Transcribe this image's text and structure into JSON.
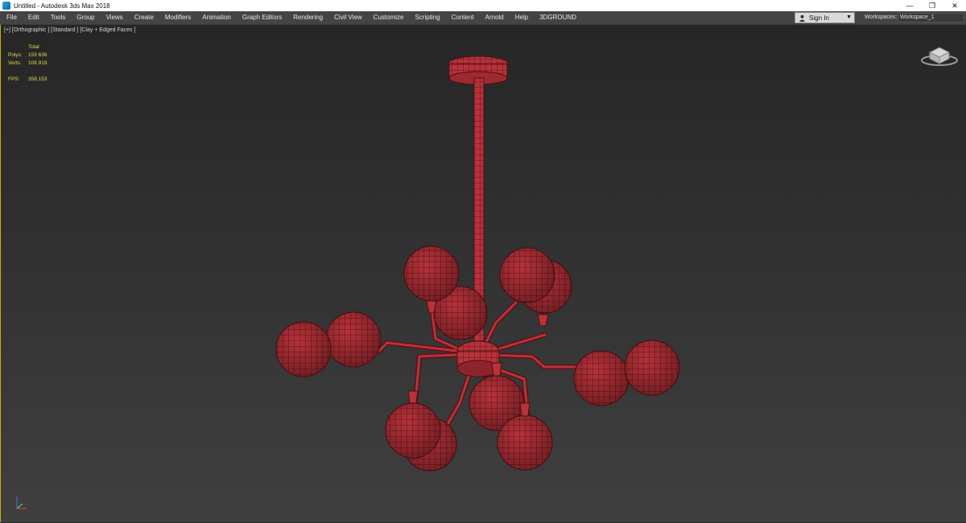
{
  "window": {
    "title": "Untitled - Autodesk 3ds Max 2018",
    "controls": [
      "—",
      "❐",
      "✕"
    ]
  },
  "menu": {
    "items": [
      "File",
      "Edit",
      "Tools",
      "Group",
      "Views",
      "Create",
      "Modifiers",
      "Animation",
      "Graph Editors",
      "Rendering",
      "Civil View",
      "Customize",
      "Scripting",
      "Content",
      "Arnold",
      "Help",
      "3DGROUND"
    ],
    "sign_in": "Sign In",
    "workspaces_label": "Workspaces:",
    "workspace_value": "Workspace_1"
  },
  "viewport": {
    "label": "[+] [Orthographic ] [Standard ] [Clay + Edged Faces ]",
    "stats": {
      "header": "Total",
      "polys_label": "Polys:",
      "polys_value": "159 636",
      "verts_label": "Verts:",
      "verts_value": "108 919",
      "fps_label": "FPS:",
      "fps_value": "358,153"
    },
    "model_color": "#b8323a",
    "wire_color": "#4a0e12"
  }
}
